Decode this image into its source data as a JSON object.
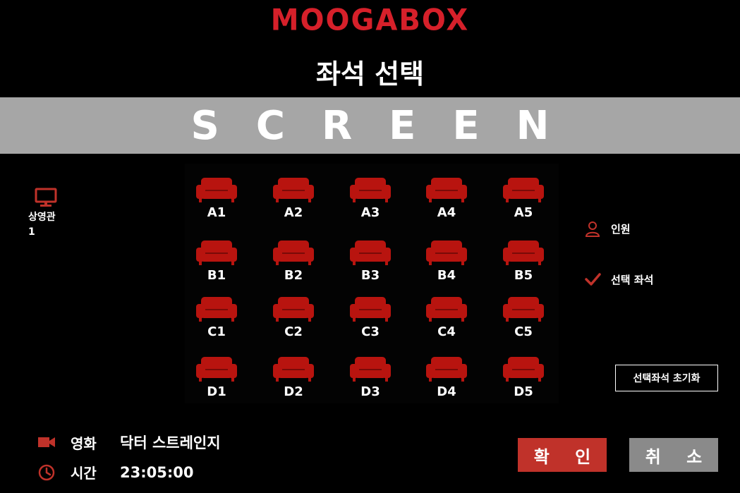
{
  "brand": "MOOGABOX",
  "page_title": "좌석 선택",
  "screen_label": "SCREEN",
  "theater": {
    "icon": "monitor-icon",
    "label": "상영관",
    "value": "1"
  },
  "seats": {
    "rows": [
      [
        "A1",
        "A2",
        "A3",
        "A4",
        "A5"
      ],
      [
        "B1",
        "B2",
        "B3",
        "B4",
        "B5"
      ],
      [
        "C1",
        "C2",
        "C3",
        "C4",
        "C5"
      ],
      [
        "D1",
        "D2",
        "D3",
        "D4",
        "D5"
      ]
    ],
    "seat_icon": "sofa-icon",
    "seat_color": "#b8140f"
  },
  "legend": {
    "people_label": "인원",
    "selected_label": "선택 좌석"
  },
  "reset_label": "선택좌석 초기화",
  "movie": {
    "label": "영화",
    "value": "닥터 스트레인지"
  },
  "time": {
    "label": "시간",
    "value": "23:05:00"
  },
  "buttons": {
    "confirm": "확 인",
    "cancel": "취 소"
  },
  "colors": {
    "accent": "#c0322a",
    "screen": "#a6a6a6",
    "cancel": "#8a8a8a",
    "brand": "#d6202a"
  }
}
